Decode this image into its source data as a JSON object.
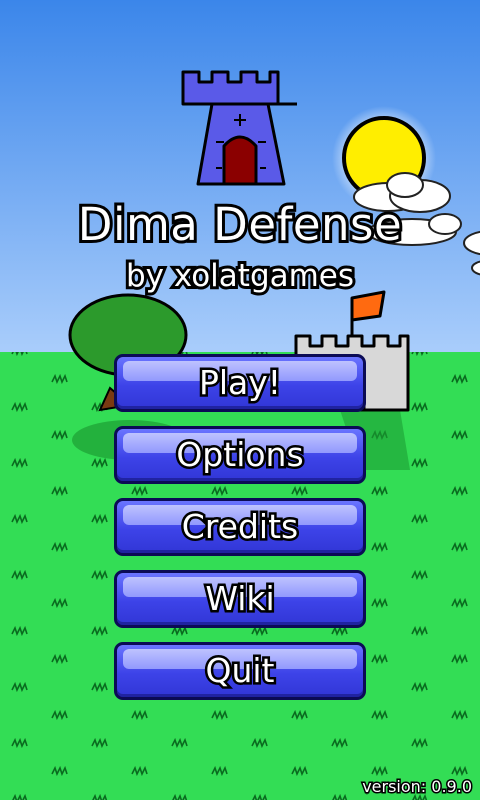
{
  "title": "Dima Defense",
  "subtitle": "by xolatgames",
  "menu": {
    "items": [
      {
        "id": "play",
        "label": "Play!"
      },
      {
        "id": "options",
        "label": "Options"
      },
      {
        "id": "credits",
        "label": "Credits"
      },
      {
        "id": "wiki",
        "label": "Wiki"
      },
      {
        "id": "quit",
        "label": "Quit"
      }
    ]
  },
  "version": "version: 0.9.0",
  "colors": {
    "sky": "#4a94ee",
    "grass": "#33dd55",
    "button": "#3d43e8",
    "tower": "#5a5ae8",
    "sun": "#ffee00",
    "flag": "#ff6a10"
  },
  "icons": {
    "tower": "blue-tower-icon",
    "castle": "grey-castle-icon",
    "sun": "sun-icon",
    "tree": "tree-icon"
  }
}
